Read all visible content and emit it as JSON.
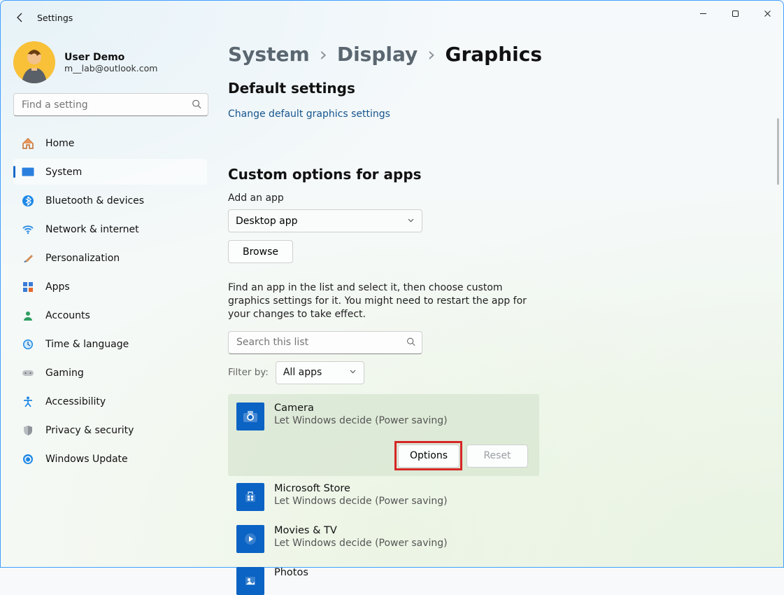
{
  "window": {
    "title": "Settings"
  },
  "profile": {
    "name": "User Demo",
    "email": "m__lab@outlook.com"
  },
  "search": {
    "placeholder": "Find a setting"
  },
  "sidebar": {
    "items": [
      {
        "label": "Home",
        "icon": "home-icon"
      },
      {
        "label": "System",
        "icon": "system-icon"
      },
      {
        "label": "Bluetooth & devices",
        "icon": "bluetooth-icon"
      },
      {
        "label": "Network & internet",
        "icon": "wifi-icon"
      },
      {
        "label": "Personalization",
        "icon": "brush-icon"
      },
      {
        "label": "Apps",
        "icon": "apps-icon"
      },
      {
        "label": "Accounts",
        "icon": "account-icon"
      },
      {
        "label": "Time & language",
        "icon": "clock-icon"
      },
      {
        "label": "Gaming",
        "icon": "gaming-icon"
      },
      {
        "label": "Accessibility",
        "icon": "accessibility-icon"
      },
      {
        "label": "Privacy & security",
        "icon": "shield-icon"
      },
      {
        "label": "Windows Update",
        "icon": "update-icon"
      }
    ],
    "active_index": 1
  },
  "breadcrumb": {
    "parent1": "System",
    "parent2": "Display",
    "current": "Graphics"
  },
  "sections": {
    "default_title": "Default settings",
    "default_link": "Change default graphics settings",
    "custom_title": "Custom options for apps",
    "add_app_label": "Add an app",
    "app_type_selected": "Desktop app",
    "browse_label": "Browse",
    "list_help": "Find an app in the list and select it, then choose custom graphics settings for it. You might need to restart the app for your changes to take effect.",
    "search_list_placeholder": "Search this list",
    "filter_label": "Filter by:",
    "filter_selected": "All apps"
  },
  "selected_app": {
    "name": "Camera",
    "preference": "Let Windows decide (Power saving)",
    "options_label": "Options",
    "reset_label": "Reset",
    "icon_bg": "#0b63c4"
  },
  "app_list": [
    {
      "name": "Microsoft Store",
      "preference": "Let Windows decide (Power saving)",
      "icon_bg": "#0b63c4"
    },
    {
      "name": "Movies & TV",
      "preference": "Let Windows decide (Power saving)",
      "icon_bg": "#0b63c4"
    },
    {
      "name": "Photos",
      "preference": "",
      "icon_bg": "#0b63c4"
    }
  ],
  "highlight": {
    "target": "options-button"
  }
}
